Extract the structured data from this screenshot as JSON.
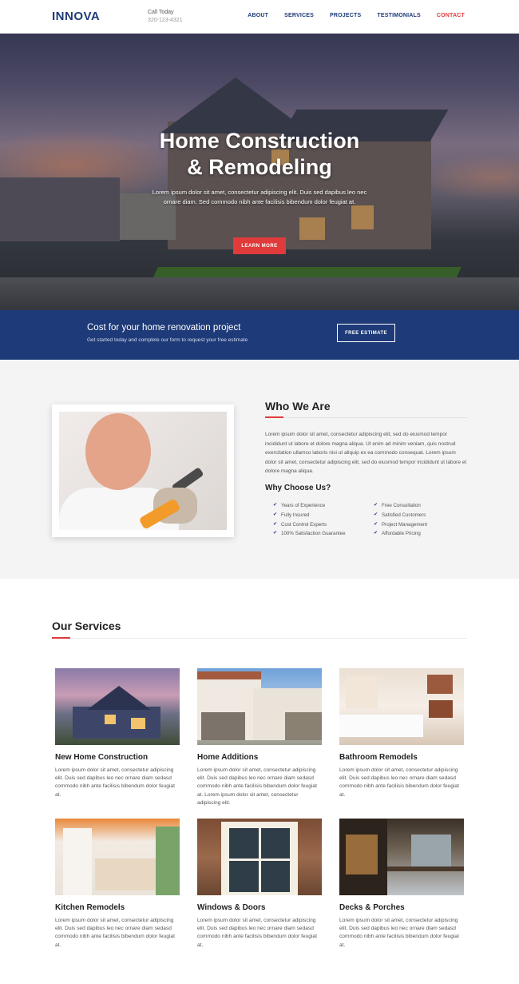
{
  "header": {
    "logo": "INNOVA",
    "call_label": "Call Today",
    "call_number": "320-123-4321",
    "nav": [
      "ABOUT",
      "SERVICES",
      "PROJECTS",
      "TESTIMONIALS",
      "CONTACT"
    ]
  },
  "hero": {
    "title_line1": "Home Construction",
    "title_line2": "& Remodeling",
    "text": "Lorem ipsum dolor sit amet, consectetur adipiscing elit. Duis sed dapibus leo nec ornare diam. Sed commodo nibh ante facilisis bibendum dolor feugiat at.",
    "button": "LEARN MORE"
  },
  "band": {
    "title": "Cost for your home renovation project",
    "subtitle": "Get started today and complete our form to request your free estimate",
    "button": "FREE ESTIMATE"
  },
  "who": {
    "title": "Who We Are",
    "text": "Lorem ipsum dolor sit amet, consectetur adipiscing elit, sed do eiusmod tempor incididunt ut labore et dolore magna aliqua. Ut enim ad minim veniam, quis nostrud exercitation ullamco laboris nisi ut aliquip ex ea commodo consequat. Lorem ipsum dolor sit amet, consectetur adipiscing elit, sed do eiusmod tempor incididunt ut labore et dolore magna aliqua.",
    "why_title": "Why Choose Us?",
    "checks_left": [
      "Years of Experience",
      "Fully Insured",
      "Cost Control Experts",
      "100% Satisfaction Guarantee"
    ],
    "checks_right": [
      "Free Consultation",
      "Satisfied Customers",
      "Project Management",
      "Affordable Pricing"
    ]
  },
  "services": {
    "title": "Our Services",
    "cards": [
      {
        "title": "New Home Construction",
        "text": "Lorem ipsum dolor sit amet, consectetur adipiscing elit. Duis sed dapibus leo nec ornare diam sedasd commodo nibh ante facilisis bibendum dolor feugiat at."
      },
      {
        "title": "Home Additions",
        "text": "Lorem ipsum dolor sit amet, consectetur adipiscing elit. Duis sed dapibus leo nec ornare diam sedasd commodo nibh ante facilisis bibendum dolor feugiat at. Lorem ipsum dolor sit amet, consectetur adipiscing elit."
      },
      {
        "title": "Bathroom Remodels",
        "text": "Lorem ipsum dolor sit amet, consectetur adipiscing elit. Duis sed dapibus leo nec ornare diam sedasd commodo nibh ante facilisis bibendum dolor feugiat at."
      },
      {
        "title": "Kitchen Remodels",
        "text": "Lorem ipsum dolor sit amet, consectetur adipiscing elit. Duis sed dapibus leo nec ornare diam sedasd commodo nibh ante facilisis bibendum dolor feugiat at."
      },
      {
        "title": "Windows & Doors",
        "text": "Lorem ipsum dolor sit amet, consectetur adipiscing elit. Duis sed dapibus leo nec ornare diam sedasd commodo nibh ante facilisis bibendum dolor feugiat at."
      },
      {
        "title": "Decks & Porches",
        "text": "Lorem ipsum dolor sit amet, consectetur adipiscing elit. Duis sed dapibus leo nec ornare diam sedasd commodo nibh ante facilisis bibendum dolor feugiat at."
      }
    ]
  },
  "colors": {
    "brand_blue": "#1e3a78",
    "accent_red": "#e03a3a"
  }
}
